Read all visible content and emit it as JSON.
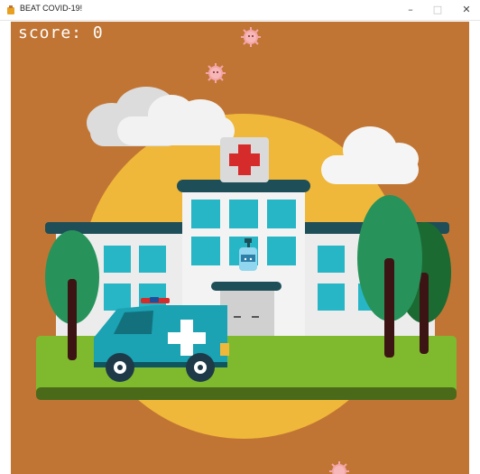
{
  "window": {
    "title": "BEAT COVID-19!",
    "minimize_glyph": "–",
    "maximize_glyph": "□",
    "close_glyph": "✕"
  },
  "hud": {
    "score_label": "score: 0"
  },
  "colors": {
    "background": "#c17534",
    "sun": "#f0b83a",
    "grass": "#7fba2e",
    "hospital_wall": "#ececec",
    "window_glass": "#27b6c6",
    "ambulance": "#1ba2b3",
    "cross": "#d62b2b"
  },
  "icons": [
    "coronavirus-icon",
    "hand-sanitizer-player-icon",
    "app-icon"
  ]
}
